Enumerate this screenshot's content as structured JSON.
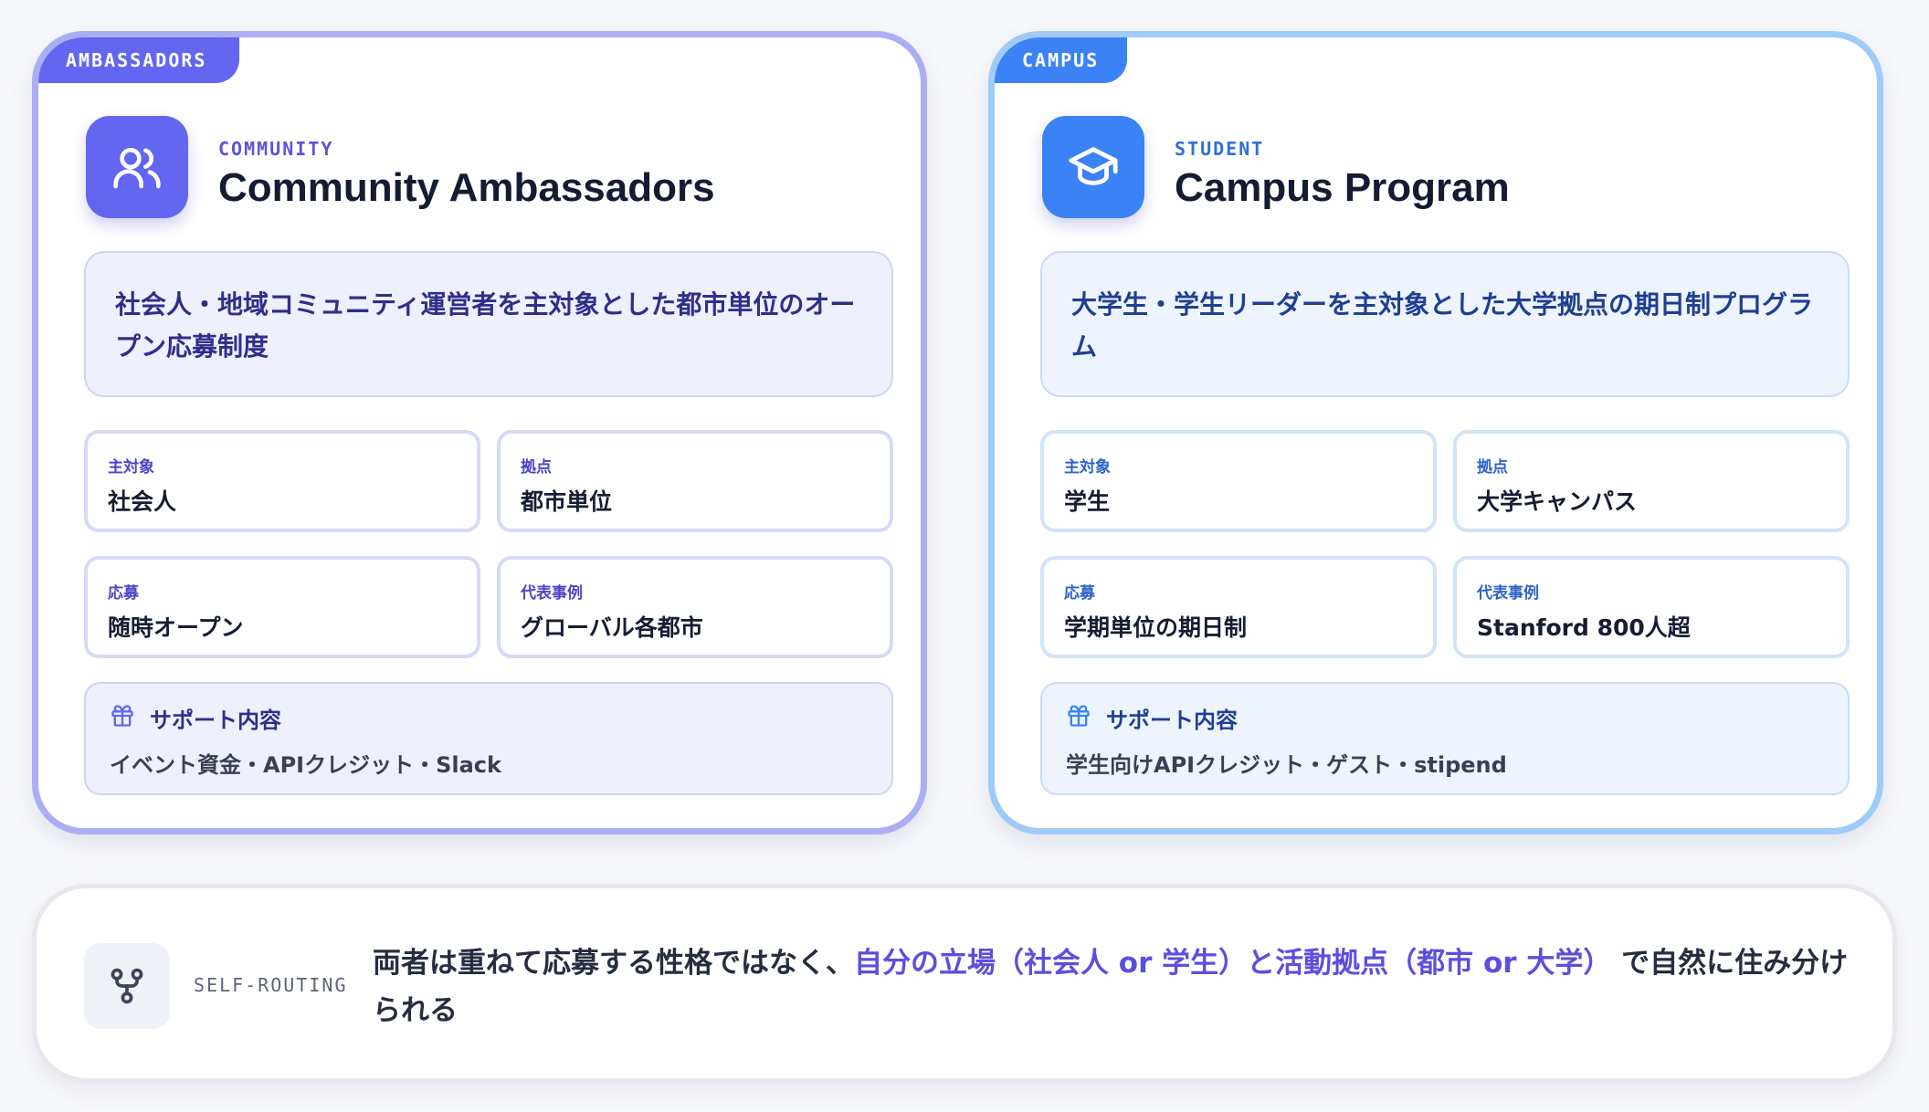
{
  "cards": [
    {
      "tab": "AMBASSADORS",
      "icon": "users-icon",
      "eyebrow": "COMMUNITY",
      "title": "Community Ambassadors",
      "description": "社会人・地域コミュニティ運営者を主対象とした都市単位のオープン応募制度",
      "meta": [
        {
          "label": "主対象",
          "value": "社会人"
        },
        {
          "label": "拠点",
          "value": "都市単位"
        },
        {
          "label": "応募",
          "value": "随時オープン"
        },
        {
          "label": "代表事例",
          "value": "グローバル各都市"
        }
      ],
      "support": {
        "heading": "サポート内容",
        "body": "イベント資金・APIクレジット・Slack"
      },
      "accent": "#6366f1"
    },
    {
      "tab": "CAMPUS",
      "icon": "graduation-cap-icon",
      "eyebrow": "STUDENT",
      "title": "Campus Program",
      "description": "大学生・学生リーダーを主対象とした大学拠点の期日制プログラム",
      "meta": [
        {
          "label": "主対象",
          "value": "学生"
        },
        {
          "label": "拠点",
          "value": "大学キャンパス"
        },
        {
          "label": "応募",
          "value": "学期単位の期日制"
        },
        {
          "label": "代表事例",
          "value": "Stanford 800人超"
        }
      ],
      "support": {
        "heading": "サポート内容",
        "body": "学生向けAPIクレジット・ゲスト・stipend"
      },
      "accent": "#3b82f6"
    }
  ],
  "routing": {
    "label": "SELF-ROUTING",
    "icon": "branch-icon",
    "text_before": "両者は重ねて応募する性格ではなく、",
    "text_highlight": "自分の立場（社会人 or 学生）と活動拠点（都市 or 大学）",
    "text_after": "で自然に住み分けられる"
  }
}
